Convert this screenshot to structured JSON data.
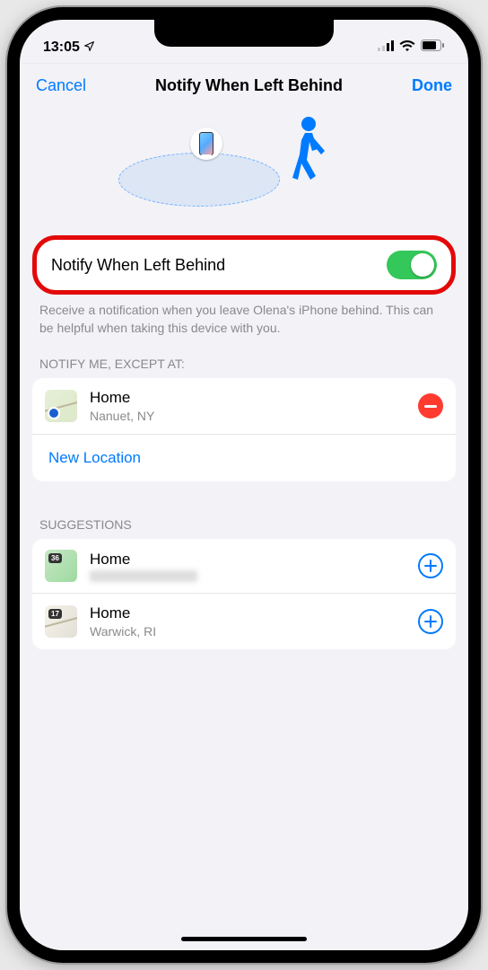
{
  "status": {
    "time": "13:05"
  },
  "nav": {
    "cancel": "Cancel",
    "title": "Notify When Left Behind",
    "done": "Done"
  },
  "toggle": {
    "label": "Notify When Left Behind",
    "on": true
  },
  "description": "Receive a notification when you leave Olena's iPhone behind. This can be helpful when taking this device with you.",
  "exceptions": {
    "header": "Notify Me, Except At:",
    "items": [
      {
        "title": "Home",
        "subtitle": "Nanuet, NY",
        "map_label": ""
      }
    ],
    "new_location": "New Location"
  },
  "suggestions": {
    "header": "Suggestions",
    "items": [
      {
        "title": "Home",
        "subtitle": "",
        "map_label": "36"
      },
      {
        "title": "Home",
        "subtitle": "Warwick, RI",
        "map_label": "17"
      }
    ]
  }
}
